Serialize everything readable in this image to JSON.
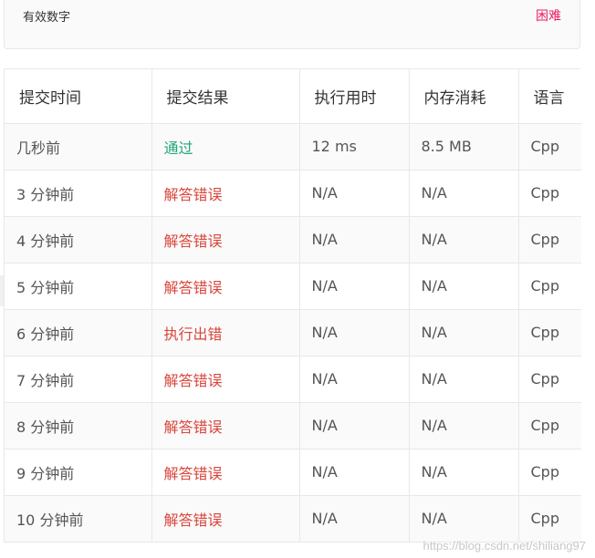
{
  "problem": {
    "title": "有效数字",
    "difficulty": "困难"
  },
  "table": {
    "headers": {
      "time": "提交时间",
      "result": "提交结果",
      "runtime": "执行用时",
      "memory": "内存消耗",
      "language": "语言"
    },
    "rows": [
      {
        "time": "几秒前",
        "result": "通过",
        "status": "accepted",
        "runtime": "12 ms",
        "memory": "8.5 MB",
        "language": "Cpp"
      },
      {
        "time": "3 分钟前",
        "result": "解答错误",
        "status": "error",
        "runtime": "N/A",
        "memory": "N/A",
        "language": "Cpp"
      },
      {
        "time": "4 分钟前",
        "result": "解答错误",
        "status": "error",
        "runtime": "N/A",
        "memory": "N/A",
        "language": "Cpp"
      },
      {
        "time": "5 分钟前",
        "result": "解答错误",
        "status": "error",
        "runtime": "N/A",
        "memory": "N/A",
        "language": "Cpp"
      },
      {
        "time": "6 分钟前",
        "result": "执行出错",
        "status": "error",
        "runtime": "N/A",
        "memory": "N/A",
        "language": "Cpp"
      },
      {
        "time": "7 分钟前",
        "result": "解答错误",
        "status": "error",
        "runtime": "N/A",
        "memory": "N/A",
        "language": "Cpp"
      },
      {
        "time": "8 分钟前",
        "result": "解答错误",
        "status": "error",
        "runtime": "N/A",
        "memory": "N/A",
        "language": "Cpp"
      },
      {
        "time": "9 分钟前",
        "result": "解答错误",
        "status": "error",
        "runtime": "N/A",
        "memory": "N/A",
        "language": "Cpp"
      },
      {
        "time": "10 分钟前",
        "result": "解答错误",
        "status": "error",
        "runtime": "N/A",
        "memory": "N/A",
        "language": "Cpp"
      }
    ]
  },
  "colors": {
    "accepted": "#21a67a",
    "error": "#d9453b",
    "difficulty_hard": "#e91e63"
  },
  "watermark": "https://blog.csdn.net/shiliang97"
}
